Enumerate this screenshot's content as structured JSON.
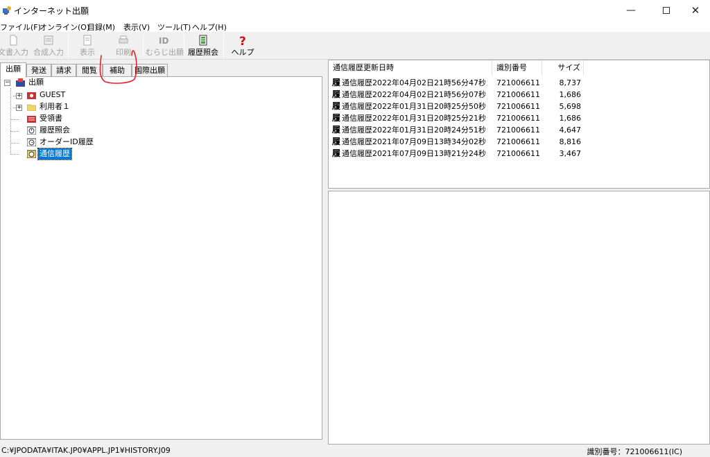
{
  "window": {
    "title": "インターネット出願",
    "controls": {
      "minimize": "—",
      "close": "✕"
    }
  },
  "menu": [
    "ファイル(F)",
    "オンライン(O)",
    "目録(M)",
    "表示(V)",
    "ツール(T)",
    "ヘルプ(H)"
  ],
  "toolbar": {
    "buttons": [
      {
        "label": "文書入力",
        "icon": "document-icon",
        "enabled": false
      },
      {
        "label": "合成入力",
        "icon": "compose-icon",
        "enabled": false
      },
      {
        "label": "表示",
        "icon": "view-icon",
        "enabled": false
      },
      {
        "label": "印刷",
        "icon": "print-icon",
        "enabled": false
      },
      {
        "label": "むらじ出願",
        "icon": "id-icon",
        "enabled": false
      },
      {
        "label": "履歴照会",
        "icon": "history-icon",
        "enabled": true
      },
      {
        "label": "ヘルプ",
        "icon": "help-icon",
        "enabled": true
      }
    ]
  },
  "tabs": [
    "出願",
    "発送",
    "請求",
    "閲覧",
    "補助",
    "国際出願"
  ],
  "active_tab": "出願",
  "tree": {
    "root": "出願",
    "items": [
      {
        "label": "GUEST",
        "icon": "user-folder-icon"
      },
      {
        "label": "利用者１",
        "icon": "folder-icon"
      },
      {
        "label": "受領書",
        "icon": "receipt-folder-icon"
      },
      {
        "label": "履歴照会",
        "icon": "history-query-icon"
      },
      {
        "label": "オーダーID履歴",
        "icon": "order-history-icon"
      },
      {
        "label": "通信履歴",
        "icon": "comm-history-icon",
        "selected": true
      }
    ]
  },
  "list": {
    "columns": [
      "通信履歴更新日時",
      "識別番号",
      "サイズ"
    ],
    "glyph": "履",
    "rows": [
      {
        "datetime": "通信履歴2022年04月02日21時56分47秒",
        "id": "721006611",
        "size": "8,737"
      },
      {
        "datetime": "通信履歴2022年04月02日21時56分07秒",
        "id": "721006611",
        "size": "1,686"
      },
      {
        "datetime": "通信履歴2022年01月31日20時25分50秒",
        "id": "721006611",
        "size": "5,698"
      },
      {
        "datetime": "通信履歴2022年01月31日20時25分21秒",
        "id": "721006611",
        "size": "1,686"
      },
      {
        "datetime": "通信履歴2022年01月31日20時24分51秒",
        "id": "721006611",
        "size": "4,647"
      },
      {
        "datetime": "通信履歴2021年07月09日13時34分02秒",
        "id": "721006611",
        "size": "8,816"
      },
      {
        "datetime": "通信履歴2021年07月09日13時21分24秒",
        "id": "721006611",
        "size": "3,467"
      }
    ]
  },
  "status": {
    "path": "C:¥JPODATA¥ITAK.JP0¥APPL.JP1¥HISTORY.J09",
    "id": "識別番号：721006611(IC)"
  },
  "colors": {
    "selection": "#0078d7",
    "annotation": "#e8202a"
  }
}
